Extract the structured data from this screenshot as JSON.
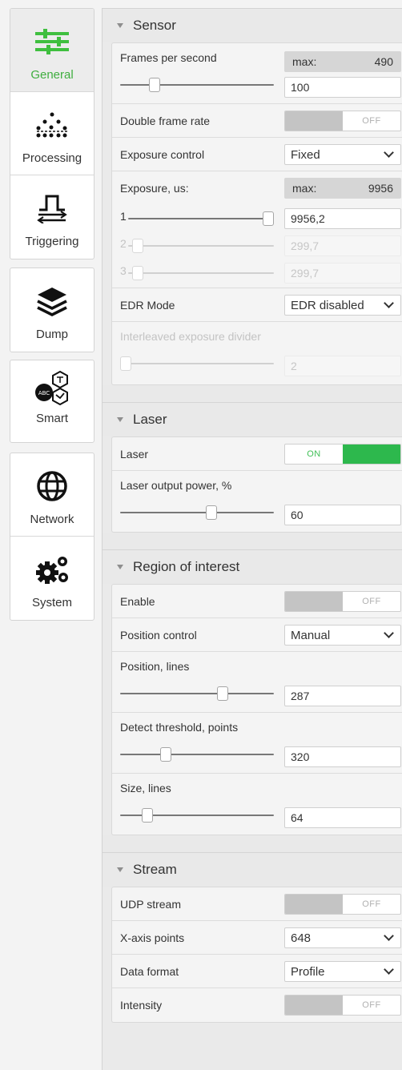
{
  "nav": {
    "items": [
      {
        "label": "General",
        "icon": "sliders-icon",
        "active": true
      },
      {
        "label": "Processing",
        "icon": "dots-icon"
      },
      {
        "label": "Triggering",
        "icon": "pulse-icon"
      },
      {
        "label": "Dump",
        "icon": "layers-icon"
      },
      {
        "label": "Smart",
        "icon": "smart-icon"
      },
      {
        "label": "Network",
        "icon": "globe-icon"
      },
      {
        "label": "System",
        "icon": "gears-icon"
      }
    ],
    "accent": "#3fae3f"
  },
  "sensor": {
    "title": "Sensor",
    "fps": {
      "label": "Frames per second",
      "max_label": "max:",
      "max_value": "490",
      "value": "100",
      "level": 0.2
    },
    "double_frame_rate": {
      "label": "Double frame rate",
      "state": "OFF"
    },
    "exposure_control": {
      "label": "Exposure control",
      "value": "Fixed"
    },
    "exposure": {
      "label": "Exposure, us:",
      "max_label": "max:",
      "max_value": "9956",
      "lines": [
        {
          "num": "1",
          "value": "9956,2",
          "level": 1.0,
          "enabled": true
        },
        {
          "num": "2",
          "value": "299,7",
          "level": 0.03,
          "enabled": false
        },
        {
          "num": "3",
          "value": "299,7",
          "level": 0.03,
          "enabled": false
        }
      ]
    },
    "edr_mode": {
      "label": "EDR Mode",
      "value": "EDR disabled"
    },
    "interleaved": {
      "label": "Interleaved exposure divider",
      "value": "2",
      "level": 0.0
    }
  },
  "laser": {
    "title": "Laser",
    "laser": {
      "label": "Laser",
      "state": "ON"
    },
    "power": {
      "label": "Laser output power, %",
      "value": "60",
      "level": 0.6
    }
  },
  "roi": {
    "title": "Region of interest",
    "enable": {
      "label": "Enable",
      "state": "OFF"
    },
    "position_control": {
      "label": "Position control",
      "value": "Manual"
    },
    "position": {
      "label": "Position, lines",
      "value": "287",
      "level": 0.68
    },
    "threshold": {
      "label": "Detect threshold, points",
      "value": "320",
      "level": 0.28
    },
    "size": {
      "label": "Size, lines",
      "value": "64",
      "level": 0.15
    }
  },
  "stream": {
    "title": "Stream",
    "udp": {
      "label": "UDP stream",
      "state": "OFF"
    },
    "xaxis": {
      "label": "X-axis points",
      "value": "648"
    },
    "format": {
      "label": "Data format",
      "value": "Profile"
    },
    "intensity": {
      "label": "Intensity",
      "state": "OFF"
    }
  }
}
